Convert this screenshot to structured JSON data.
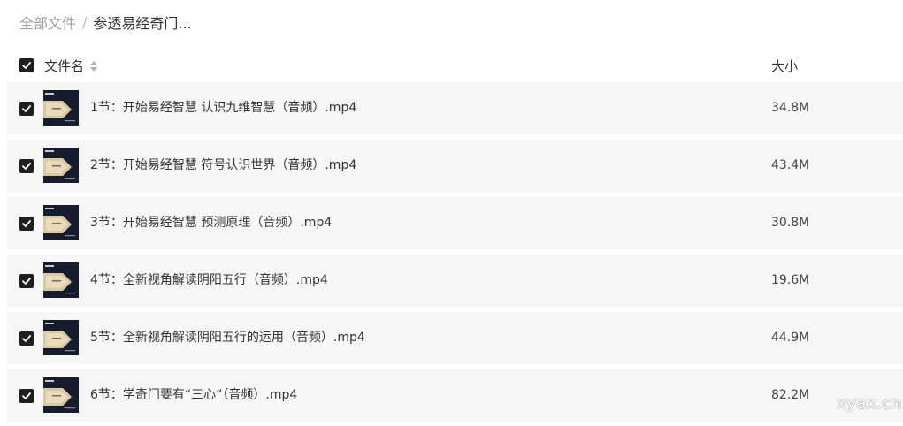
{
  "breadcrumb": {
    "root": "全部文件",
    "separator": "/",
    "current": "参透易经奇门..."
  },
  "header": {
    "name_label": "文件名",
    "size_label": "大小",
    "sort_icon": "sort-updown-icon",
    "select_all_checked": true
  },
  "files": [
    {
      "name": "1节：开始易经智慧 认识九维智慧（音频）.mp4",
      "size": "34.8M",
      "checked": true,
      "thumb_icon": "video-thumbnail"
    },
    {
      "name": "2节：开始易经智慧 符号认识世界（音频）.mp4",
      "size": "43.4M",
      "checked": true,
      "thumb_icon": "video-thumbnail"
    },
    {
      "name": "3节：开始易经智慧 预测原理（音频）.mp4",
      "size": "30.8M",
      "checked": true,
      "thumb_icon": "video-thumbnail"
    },
    {
      "name": "4节：全新视角解读阴阳五行（音频）.mp4",
      "size": "19.6M",
      "checked": true,
      "thumb_icon": "video-thumbnail"
    },
    {
      "name": "5节：全新视角解读阴阳五行的运用（音频）.mp4",
      "size": "44.9M",
      "checked": true,
      "thumb_icon": "video-thumbnail"
    },
    {
      "name": "6节：学奇门要有“三心”（音频）.mp4",
      "size": "82.2M",
      "checked": true,
      "thumb_icon": "video-thumbnail"
    }
  ],
  "watermark": "xyax.cn",
  "colors": {
    "row_bg": "#f6f6f6",
    "checkbox": "#1f1f1f",
    "thumb_bg": "#141c2e",
    "thumb_accent": "#d9c9a0"
  }
}
